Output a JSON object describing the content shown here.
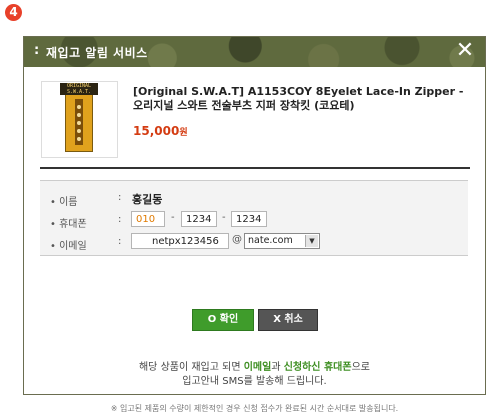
{
  "step_badge": "4",
  "dialog": {
    "title_bullet": ":",
    "title": "재입고 알림 서비스",
    "close_icon_glyph": "✕"
  },
  "product": {
    "name": "[Original S.W.A.T] A1153COY 8Eyelet Lace-In Zipper - 오리지널 스와트 전술부츠 지퍼 장착킷 (코요테)",
    "price": "15,000",
    "price_unit": "원",
    "thumb_label": "ORIGINAL S.W.A.T."
  },
  "form": {
    "name_label": "• 이름",
    "name_value": "홍길동",
    "phone_label": "• 휴대폰",
    "phone_prefix": "010",
    "phone_middle": "1234",
    "phone_last": "1234",
    "dash": "-",
    "email_label": "• 이메일",
    "email_id": "netpx123456",
    "at": "@",
    "email_domain": "nate.com",
    "colon": ":"
  },
  "buttons": {
    "ok_label": "O  확인",
    "cancel_label": "X  취소"
  },
  "notice": {
    "line1_pre": "해당 상품이 재입고 되면 ",
    "line1_email": "이메일",
    "line1_and": "과 ",
    "line1_phone": "신청하신 휴대폰",
    "line1_post": "으로",
    "line2": "입고안내 SMS를 발송해 드립니다.",
    "small": "※ 입고된 제품의 수량이 제한적인 경우 신청 접수가 완료된 시간 순서대로 발송됩니다."
  },
  "colors": {
    "accent_green": "#3f9c2b",
    "price_red": "#d43c12",
    "titlebar_camo": "#5f6a3e",
    "badge_red": "#e8412a"
  }
}
